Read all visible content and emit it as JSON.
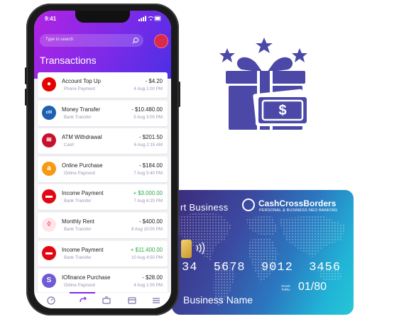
{
  "phone": {
    "status_time": "9:41",
    "search_placeholder": "Type to search",
    "page_title": "Transactions",
    "transactions": [
      {
        "title": "Account Top Up",
        "subtitle": "Phone Payment",
        "amount": "- $4.20",
        "date": "4 Aug 1:00 PM",
        "logo": "vodafone-logo",
        "color": "#e60000",
        "positive": false
      },
      {
        "title": "Money Transfer",
        "subtitle": "Bank Transfer",
        "amount": "- $10.480.00",
        "date": "5 Aug 3:00 PM",
        "logo": "citi-logo",
        "color": "#1d5fb0",
        "positive": false
      },
      {
        "title": "ATM Withdrawal",
        "subtitle": "Cash",
        "amount": "- $201.50",
        "date": "6 Aug 2:15 AM",
        "logo": "bank-of-america-logo",
        "color": "#c8102e",
        "positive": false
      },
      {
        "title": "Online Purchase",
        "subtitle": "Online Payment",
        "amount": "- $184.00",
        "date": "7 Aug 5:40 PM",
        "logo": "amazon-logo",
        "color": "#f59a12",
        "positive": false
      },
      {
        "title": "Income Payment",
        "subtitle": "Bank Transfer",
        "amount": "+ $3.000.00",
        "date": "7 Aug 6:20 PM",
        "logo": "santander-logo",
        "color": "#e30613",
        "positive": true
      },
      {
        "title": "Monthly Rent",
        "subtitle": "Bank Transfer",
        "amount": "- $400.00",
        "date": "8 Aug 10:00 PM",
        "logo": "airbnb-logo",
        "color": "#ffe5ea",
        "positive": false
      },
      {
        "title": "Income Payment",
        "subtitle": "Bank Transfer",
        "amount": "+ $11.400.00",
        "date": "10 Aug 4:50 PM",
        "logo": "santander-logo",
        "color": "#e30613",
        "positive": true
      },
      {
        "title": "IOfinance Purchase",
        "subtitle": "Online Payment",
        "amount": "- $28.00",
        "date": "4 Aug 1:00 PM",
        "logo": "iofinance-logo",
        "color": "#6e5bd6",
        "positive": false
      }
    ],
    "tabs": [
      "dashboard-icon",
      "transfer-icon",
      "cards-icon",
      "wallet-icon",
      "menu-icon"
    ],
    "accent": "#7d2ae8"
  },
  "card": {
    "business_label": "rt Business",
    "brand": "CashCrossBorders",
    "tagline": "PERSONAL & BUSINESS NEO BANKING",
    "number": "34  5678  9012  3456",
    "valid_label_1": "VALID",
    "valid_label_2": "THRU",
    "valid_value": "01/80",
    "holder": "Business Name"
  },
  "gift": {
    "icon": "gift-money-icon",
    "color": "#4b48a8"
  }
}
